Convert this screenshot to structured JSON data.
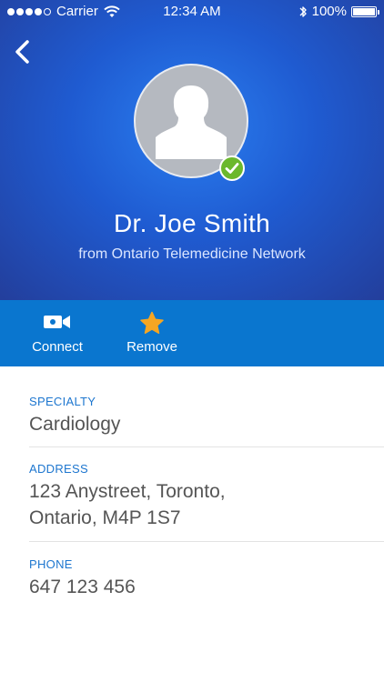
{
  "status_bar": {
    "carrier": "Carrier",
    "time": "12:34 AM",
    "battery_pct": "100%",
    "signal_filled": 4,
    "signal_total": 5
  },
  "profile": {
    "name": "Dr. Joe Smith",
    "organization": "from Ontario Telemedicine Network",
    "verified": true
  },
  "actions": {
    "connect_label": "Connect",
    "remove_label": "Remove",
    "accent_star": "#f5a623"
  },
  "details": {
    "specialty": {
      "label": "SPECIALTY",
      "value": "Cardiology"
    },
    "address": {
      "label": "ADDRESS",
      "line1": "123 Anystreet, Toronto,",
      "line2": "Ontario, M4P 1S7"
    },
    "phone": {
      "label": "PHONE",
      "value": "647 123 456"
    }
  },
  "colors": {
    "header_dark": "#233f9d",
    "header_light": "#2a7ef0",
    "action_bar": "#0a76cf",
    "label_blue": "#1d76cf",
    "verified_green": "#6bb82d"
  }
}
